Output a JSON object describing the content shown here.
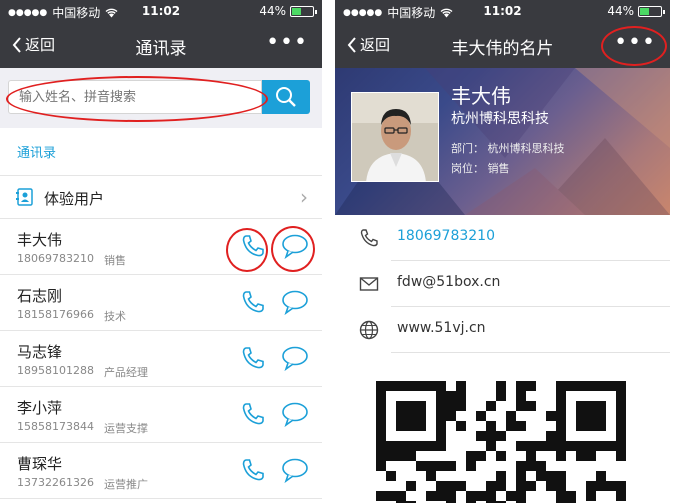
{
  "status_bar": {
    "carrier": "中国移动",
    "time": "11:02",
    "battery": "44%",
    "battery_level": 0.44
  },
  "left": {
    "nav": {
      "back_label": "返回",
      "title": "通讯录"
    },
    "search": {
      "placeholder": "输入姓名、拼音搜索"
    },
    "section_label": "通讯录",
    "trial_label": "体验用户",
    "contacts": [
      {
        "name": "丰大伟",
        "phone": "18069783210",
        "role": "销售"
      },
      {
        "name": "石志刚",
        "phone": "18158176966",
        "role": "技术"
      },
      {
        "name": "马志锋",
        "phone": "18958101288",
        "role": "产品经理"
      },
      {
        "name": "李小萍",
        "phone": "15858173844",
        "role": "运营支撑"
      },
      {
        "name": "曹琛华",
        "phone": "13732261326",
        "role": "运营推广"
      }
    ]
  },
  "right": {
    "nav": {
      "back_label": "返回",
      "title": "丰大伟的名片"
    },
    "card": {
      "name": "丰大伟",
      "company": "杭州博科思科技",
      "dept": "部门：  杭州博科思科技",
      "position": "岗位：  销售"
    },
    "phone": "18069783210",
    "email": "fdw@51box.cn",
    "website": "www.51vj.cn"
  },
  "colors": {
    "accent": "#1ca0d8",
    "navbar": "#393a3f",
    "annotation": "#e02020"
  }
}
